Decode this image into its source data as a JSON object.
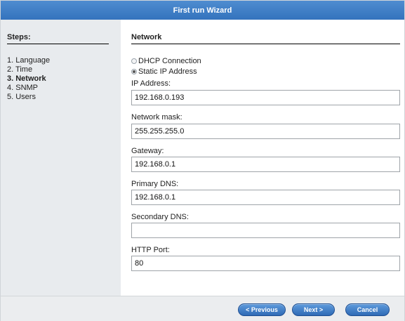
{
  "window": {
    "title": "First run Wizard"
  },
  "sidebar": {
    "title": "Steps:",
    "items": [
      {
        "label": "1. Language",
        "active": false
      },
      {
        "label": "2. Time",
        "active": false
      },
      {
        "label": "3. Network",
        "active": true
      },
      {
        "label": "4. SNMP",
        "active": false
      },
      {
        "label": "5. Users",
        "active": false
      }
    ]
  },
  "network": {
    "title": "Network",
    "dhcp_label": "DHCP Connection",
    "static_label": "Static IP Address",
    "selected_mode": "static",
    "fields": {
      "ip_address": {
        "label": "IP Address:",
        "value": "192.168.0.193"
      },
      "network_mask": {
        "label": "Network mask:",
        "value": "255.255.255.0"
      },
      "gateway": {
        "label": "Gateway:",
        "value": "192.168.0.1"
      },
      "primary_dns": {
        "label": "Primary DNS:",
        "value": "192.168.0.1"
      },
      "secondary_dns": {
        "label": "Secondary DNS:",
        "value": ""
      },
      "http_port": {
        "label": "HTTP Port:",
        "value": "80"
      }
    }
  },
  "footer": {
    "previous_label": "< Previous",
    "next_label": "Next >",
    "cancel_label": "Cancel"
  },
  "colors": {
    "title_bar": "#3b7ac4",
    "button": "#3a78c2",
    "sidebar_bg": "#e8ebee"
  }
}
